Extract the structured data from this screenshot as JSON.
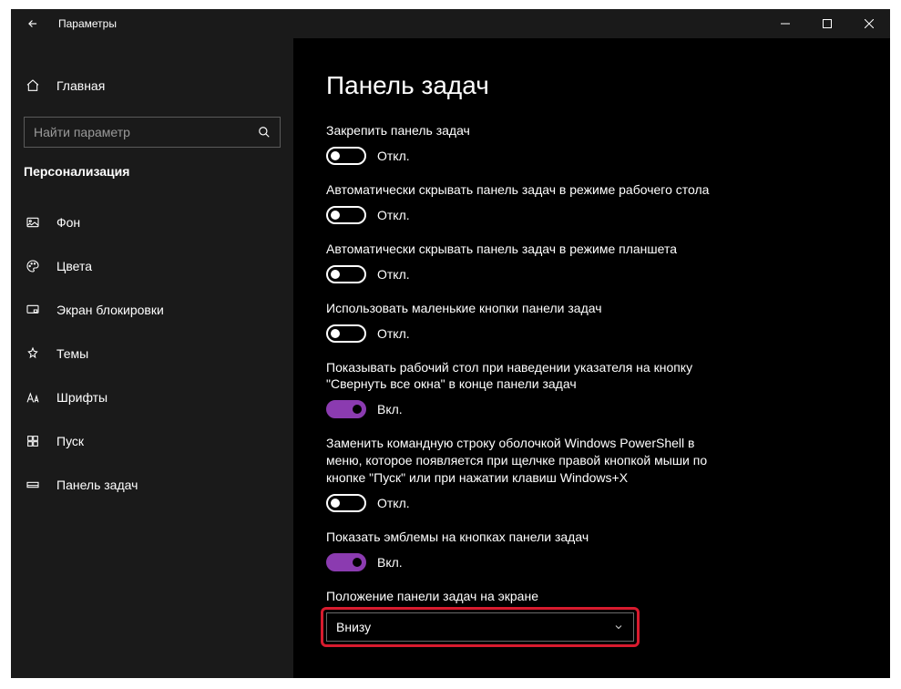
{
  "window": {
    "title": "Параметры"
  },
  "sidebar": {
    "home": "Главная",
    "search_placeholder": "Найти параметр",
    "section": "Персонализация",
    "items": [
      {
        "label": "Фон"
      },
      {
        "label": "Цвета"
      },
      {
        "label": "Экран блокировки"
      },
      {
        "label": "Темы"
      },
      {
        "label": "Шрифты"
      },
      {
        "label": "Пуск"
      },
      {
        "label": "Панель задач"
      }
    ]
  },
  "content": {
    "title": "Панель задач",
    "state_on": "Вкл.",
    "state_off": "Откл.",
    "settings": [
      {
        "label": "Закрепить панель задач",
        "on": false
      },
      {
        "label": "Автоматически скрывать панель задач в режиме рабочего стола",
        "on": false
      },
      {
        "label": "Автоматически скрывать панель задач в режиме планшета",
        "on": false
      },
      {
        "label": "Использовать маленькие кнопки панели задач",
        "on": false
      },
      {
        "label": "Показывать рабочий стол при наведении указателя на кнопку \"Свернуть все окна\" в конце панели задач",
        "on": true
      },
      {
        "label": "Заменить командную строку оболочкой Windows PowerShell в меню, которое появляется при щелчке правой кнопкой мыши по кнопке \"Пуск\" или при нажатии клавиш Windows+X",
        "on": false
      },
      {
        "label": "Показать эмблемы на кнопках панели задач",
        "on": true
      }
    ],
    "position": {
      "label": "Положение панели задач на экране",
      "value": "Внизу"
    }
  }
}
